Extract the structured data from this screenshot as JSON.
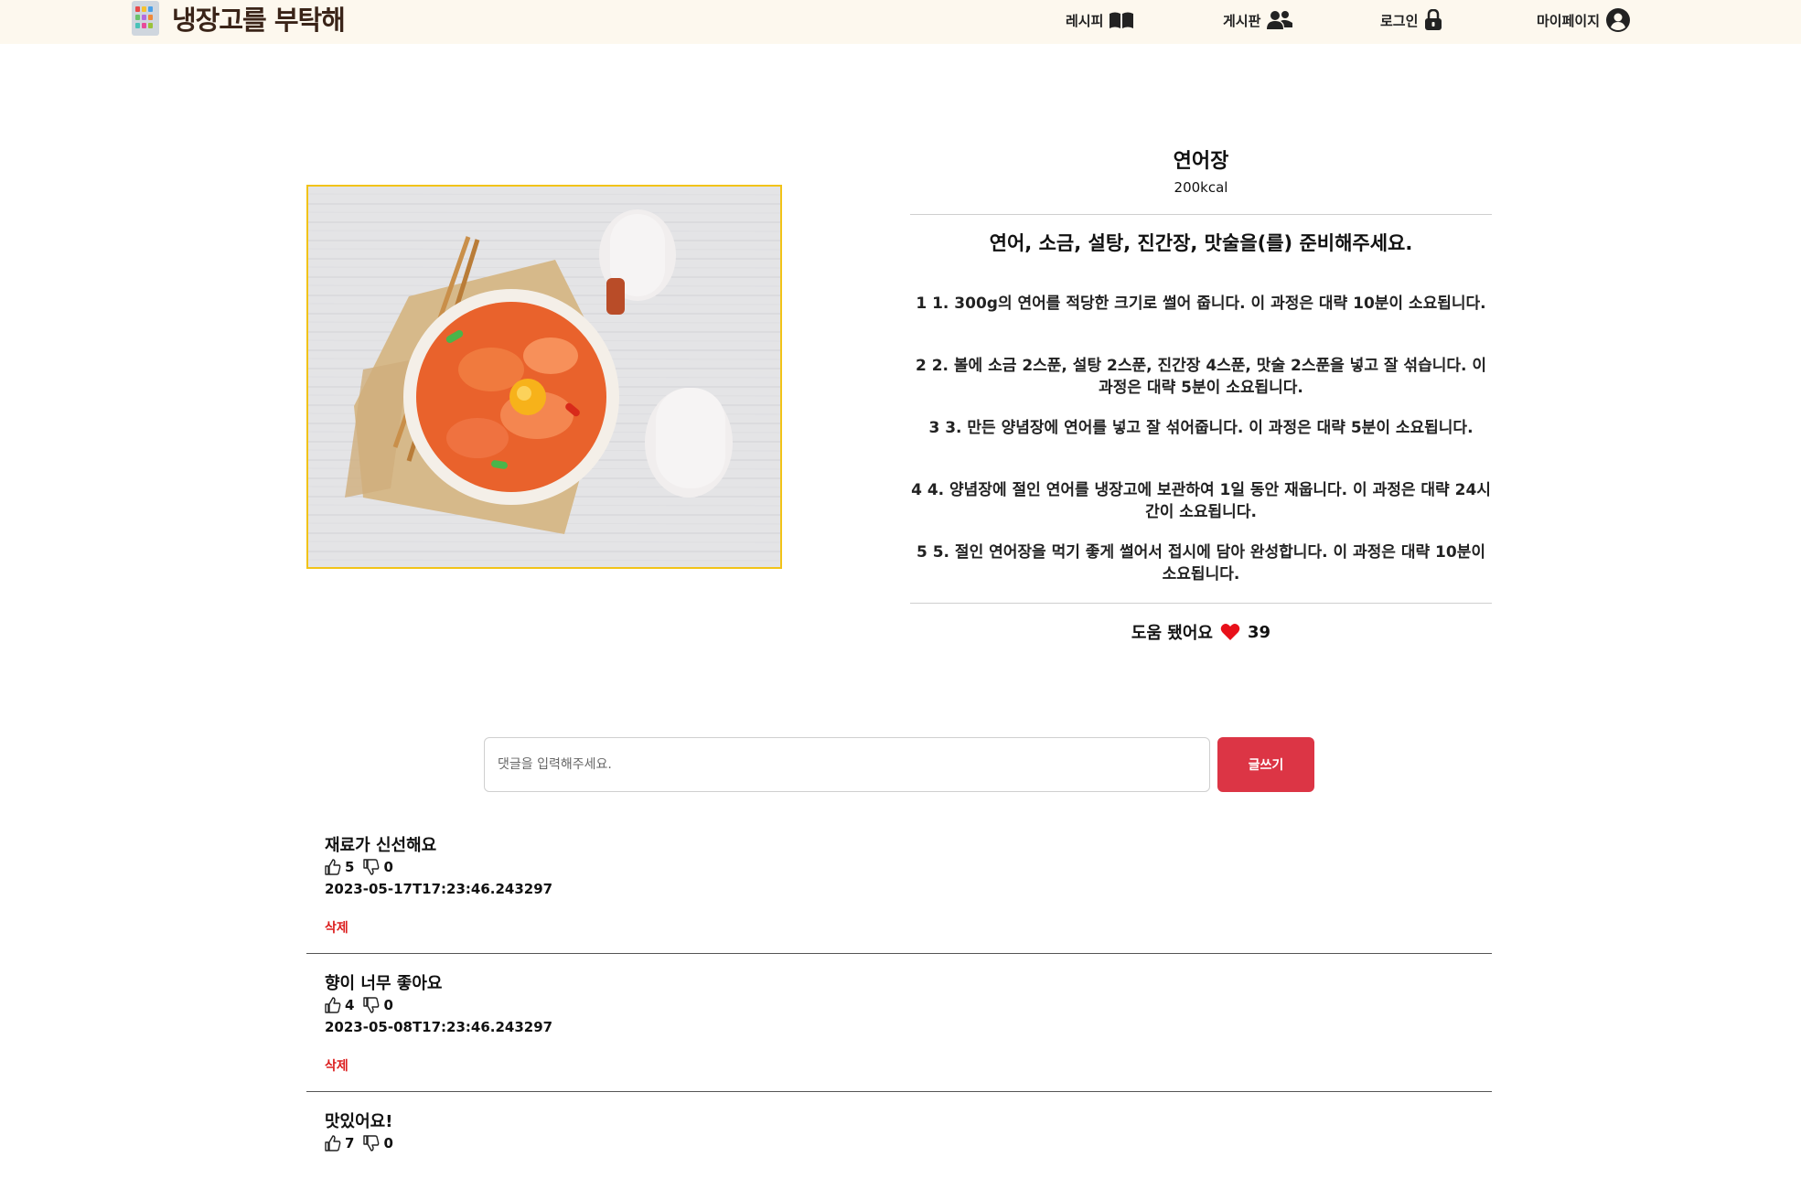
{
  "header": {
    "logo_text": "냉장고를 부탁해",
    "nav": {
      "recipe": "레시피",
      "board": "게시판",
      "login": "로그인",
      "mypage": "마이페이지"
    }
  },
  "recipe": {
    "title": "연어장",
    "kcal": "200kcal",
    "ingredients_text": "연어, 소금, 설탕, 진간장, 맛술을(를) 준비해주세요.",
    "steps": [
      "1 1. 300g의 연어를 적당한 크기로 썰어 줍니다. 이 과정은 대략 10분이 소요됩니다.",
      "2 2. 볼에 소금 2스푼, 설탕 2스푼, 진간장 4스푼, 맛술 2스푼을 넣고 잘 섞습니다. 이 과정은 대략 5분이 소요됩니다.",
      "3 3. 만든 양념장에 연어를 넣고 잘 섞어줍니다. 이 과정은 대략 5분이 소요됩니다.",
      "4 4. 양념장에 절인 연어를 냉장고에 보관하여 1일 동안 재웁니다. 이 과정은 대략 24시간이 소요됩니다.",
      "5 5. 절인 연어장을 먹기 좋게 썰어서 접시에 담아 완성합니다. 이 과정은 대략 10분이 소요됩니다."
    ],
    "helpful_label": "도움 됐어요",
    "like_count": "39"
  },
  "comment_form": {
    "placeholder": "댓글을 입력해주세요.",
    "submit_label": "글쓰기"
  },
  "comments": [
    {
      "text": "재료가 신선해요",
      "likes": "5",
      "dislikes": "0",
      "date": "2023-05-17T17:23:46.243297",
      "delete_label": "삭제"
    },
    {
      "text": "향이 너무 좋아요",
      "likes": "4",
      "dislikes": "0",
      "date": "2023-05-08T17:23:46.243297",
      "delete_label": "삭제"
    },
    {
      "text": "맛있어요!",
      "likes": "7",
      "dislikes": "0",
      "date": "",
      "delete_label": ""
    }
  ],
  "colors": {
    "header_bg": "#fdf8ee",
    "accent_red": "#dc3545",
    "delete_red": "#dc1f1f",
    "image_border": "#f2c318",
    "heart": "#e8101a"
  }
}
